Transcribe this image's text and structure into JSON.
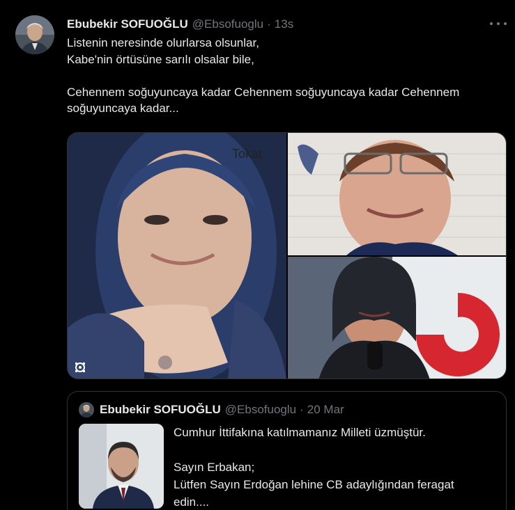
{
  "tweet": {
    "author_name": "Ebubekir SOFUOĞLU",
    "handle": "@Ebsofuoglu",
    "separator": "·",
    "time": "13s",
    "more_icon": "more-dots-icon",
    "lines": [
      "Listenin neresinde olurlarsa olsunlar,",
      "Kabe'nin örtüsüne sarılı olsalar bile,",
      "",
      "Cehennem soğuyuncaya kadar Cehennem soğuyuncaya kadar Cehennem",
      "soğuyuncaya kadar..."
    ],
    "media": {
      "watermark": "Tokat",
      "badge_icon": "alt-badge-icon"
    }
  },
  "quoted_tweet": {
    "author_name": "Ebubekir SOFUOĞLU",
    "handle": "@Ebsofuoglu",
    "separator": "·",
    "date": "20 Mar",
    "lines": [
      "Cumhur İttifakına katılmamanız Milleti üzmüştür.",
      "",
      "Sayın Erbakan;",
      "Lütfen Sayın Erdoğan lehine CB adaylığından feragat",
      "edin...."
    ]
  },
  "colors": {
    "background": "#000000",
    "text": "#e7e9ea",
    "secondary": "#71767b",
    "border": "#2f3336"
  }
}
